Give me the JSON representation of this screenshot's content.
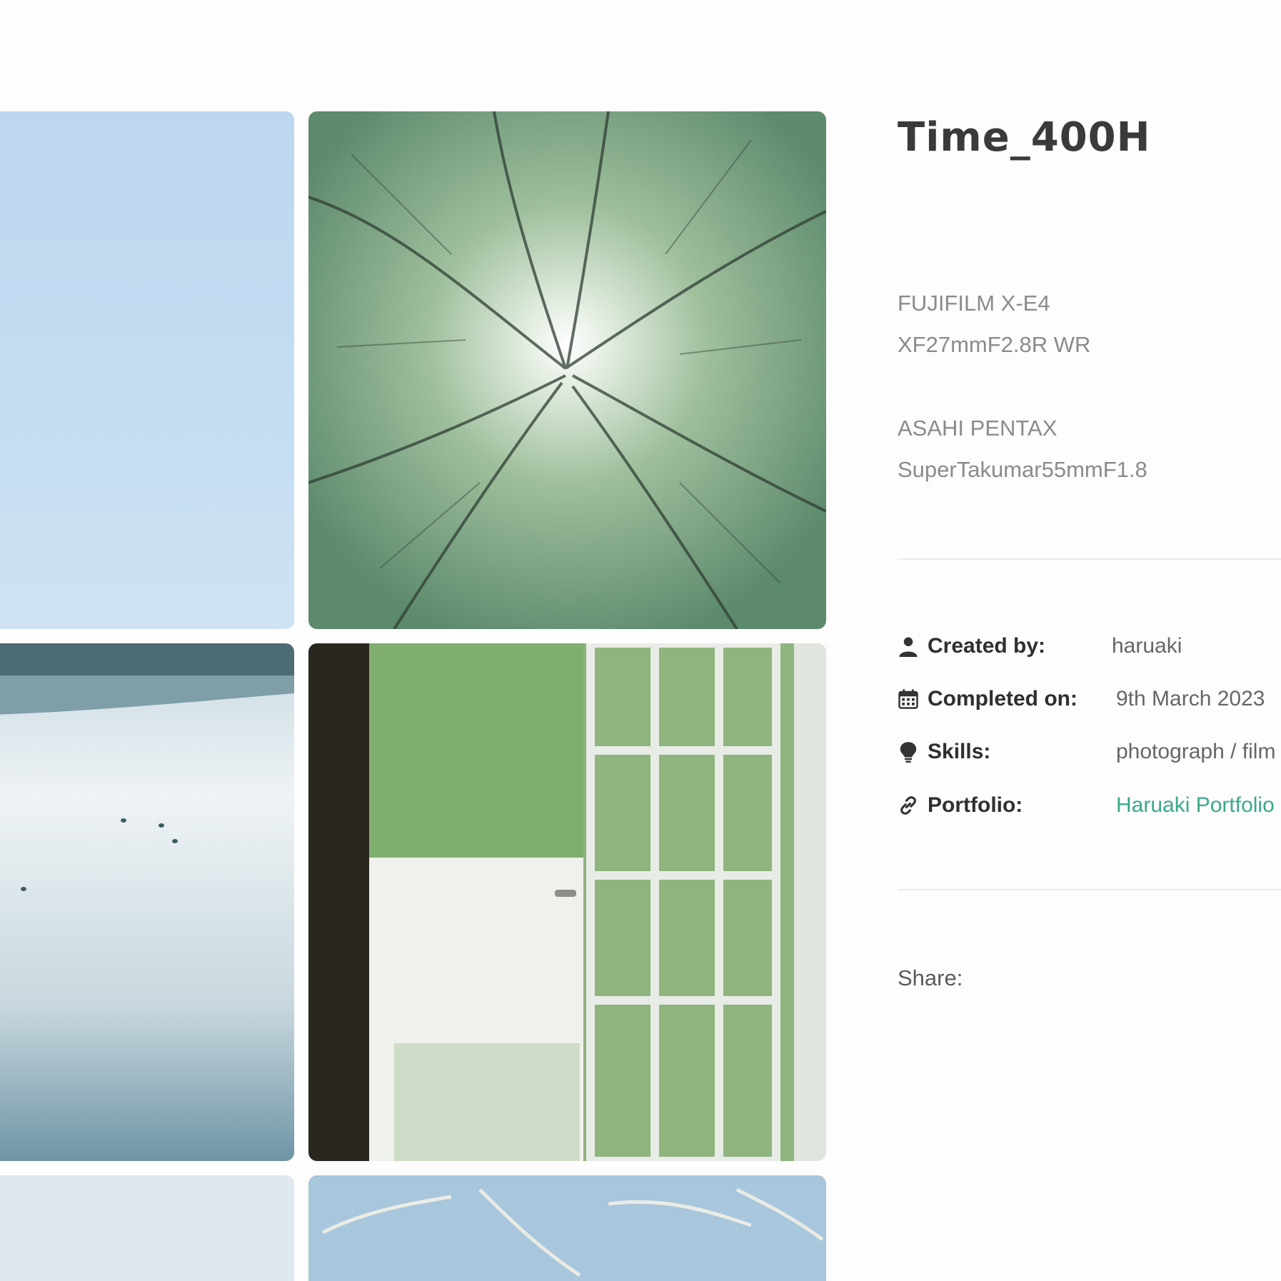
{
  "project": {
    "title": "Time_400H"
  },
  "equipment": {
    "camera_1": {
      "body": "FUJIFILM X-E4",
      "lens": "XF27mmF2.8R WR"
    },
    "camera_2": {
      "body": "ASAHI PENTAX",
      "lens": "SuperTakumar55mmF1.8"
    }
  },
  "meta": {
    "created_by": {
      "label": "Created by:",
      "value": "haruaki",
      "icon": "user-icon"
    },
    "completed_on": {
      "label": "Completed on:",
      "value": "9th March 2023",
      "icon": "calendar-icon"
    },
    "skills": {
      "label": "Skills:",
      "value": "photograph / film photography",
      "icon": "lightbulb-icon"
    },
    "portfolio": {
      "label": "Portfolio:",
      "value": "Haruaki Portfolio",
      "icon": "link-icon"
    }
  },
  "share": {
    "label": "Share:"
  },
  "gallery": {
    "photos": [
      {
        "name": "pale blue sky"
      },
      {
        "name": "sunlight through tree canopy"
      },
      {
        "name": "lake with ducks"
      },
      {
        "name": "open garden french door"
      },
      {
        "name": "pale sky"
      },
      {
        "name": "pampas grass against sky"
      }
    ]
  },
  "colors": {
    "accent_link": "#3aa98a",
    "title": "#3a3a3a",
    "muted_text": "#8b8b8b",
    "divider": "#ececec"
  }
}
